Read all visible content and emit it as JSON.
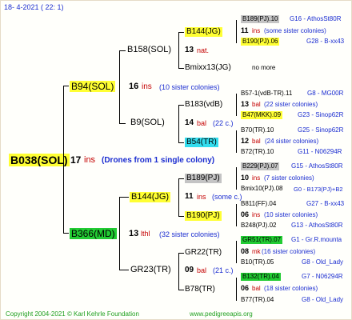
{
  "header": {
    "date": "18-  4-2021  ( 22:  1)"
  },
  "footer": {
    "copyright": "Copyright 2004-2021 © Karl Kehrle Foundation",
    "site": "www.pedigreeapis.org"
  },
  "root": {
    "name": "B038(SOL)",
    "num": "17",
    "suffix": "ins",
    "note": "(Drones from 1 single colony)"
  },
  "gen1": {
    "upper": {
      "name": "B94(SOL)",
      "num": "16",
      "suffix": "ins",
      "note": "(10 sister colonies)"
    },
    "lower": {
      "name": "B366(MD)",
      "num": "13",
      "suffix": "lthl",
      "note": "(32 sister colonies)"
    }
  },
  "gen2": {
    "a": {
      "name": "B158(SOL)",
      "num": "13",
      "suffix": "nat."
    },
    "b": {
      "name": "B9(SOL)",
      "num": "14",
      "suffix": "bal",
      "note": "(22 c.)"
    },
    "c": {
      "name": "B144(JG)",
      "num": "11",
      "suffix": "ins",
      "note": "(some c.)"
    },
    "d": {
      "name": "GR23(TR)",
      "num": "09",
      "suffix": "bal",
      "note": "(21 c.)"
    }
  },
  "gen3": {
    "a1": {
      "name": "B144(JG)"
    },
    "a2": {
      "name": "Bmixx13(JG)",
      "note": "no more"
    },
    "b1": {
      "name": "B183(vdB)"
    },
    "b2": {
      "name": "B54(TR)"
    },
    "c1": {
      "name": "B189(PJ)"
    },
    "c2": {
      "name": "B190(PJ)"
    },
    "d1": {
      "name": "GR22(TR)"
    },
    "d2": {
      "name": "B78(TR)"
    }
  },
  "gen4": [
    {
      "top": "B189(PJ).10",
      "topref": "G16 - AthosSt80R",
      "num": "11",
      "suffix": "ins",
      "note": "(some sister colonies)",
      "bottom": "B190(PJ).06",
      "bottomref": "G28 - B-xx43"
    },
    {
      "top": "B57-1(vdB-TR).11",
      "topref": "G8 - MG00R",
      "num": "13",
      "suffix": "bal",
      "note": "(22 sister colonies)",
      "bottom": "B47(MKK).09",
      "bottomref": "G23 - Sinop62R"
    },
    {
      "top": "B70(TR).10",
      "topref": "G25 - Sinop62R",
      "num": "12",
      "suffix": "bal",
      "note": "(24 sister colonies)",
      "bottom": "B72(TR).10",
      "bottomref": "G11 - N06294R"
    },
    {
      "top": "B229(PJ).07",
      "topref": "G15 - AthosSt80R",
      "num": "10",
      "suffix": "ins",
      "note": "(7 sister colonies)",
      "bottom": "Bmix10(PJ).08",
      "bottomref": "G0 - B173(PJ)+B2"
    },
    {
      "top": "B811(FF).04",
      "topref": "G27 - B-xx43",
      "num": "06",
      "suffix": "ins",
      "note": "(10 sister colonies)",
      "bottom": "B248(PJ).02",
      "bottomref": "G13 - AthosSt80R"
    },
    {
      "top": "GR51(TR).07",
      "topref": "G1 - Gr.R.mounta",
      "num": "08",
      "suffix": "mk",
      "note": "(16 sister colonies)",
      "bottom": "B10(TR).05",
      "bottomref": "G8 - Old_Lady"
    },
    {
      "top": "B132(TR).04",
      "topref": "G7 - N06294R",
      "num": "06",
      "suffix": "bal",
      "note": "(18 sister colonies)",
      "bottom": "B77(TR).04",
      "bottomref": "G8 - Old_Lady"
    }
  ],
  "colors": {
    "yellow": "#ffff33",
    "green": "#22cc33",
    "cyan": "#33ddee",
    "gray": "#c4c4c4",
    "red": "#c40000",
    "blue": "#1a2cd0"
  }
}
